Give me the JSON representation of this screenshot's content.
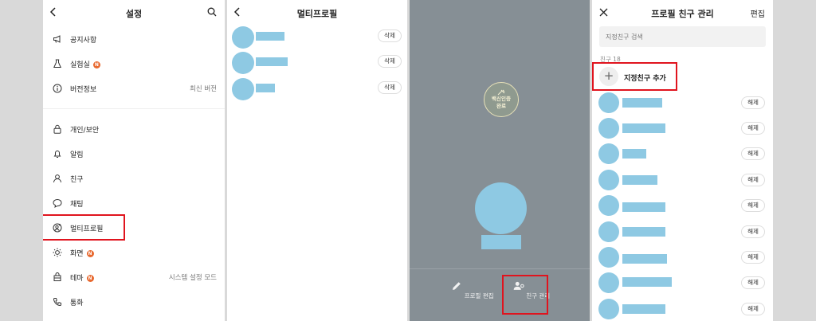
{
  "settings": {
    "title": "설정",
    "items": [
      {
        "label": "공지사항",
        "icon": "megaphone-icon",
        "new": false,
        "value": ""
      },
      {
        "label": "실험실",
        "icon": "flask-icon",
        "new": true,
        "value": ""
      },
      {
        "label": "버전정보",
        "icon": "info-icon",
        "new": false,
        "value": "최신 버전"
      },
      {
        "label": "개인/보안",
        "icon": "lock-icon",
        "new": false,
        "value": ""
      },
      {
        "label": "알림",
        "icon": "bell-icon",
        "new": false,
        "value": ""
      },
      {
        "label": "친구",
        "icon": "person-icon",
        "new": false,
        "value": ""
      },
      {
        "label": "채팅",
        "icon": "chat-bubble-icon",
        "new": false,
        "value": ""
      },
      {
        "label": "멀티프로필",
        "icon": "multi-profile-icon",
        "new": false,
        "value": ""
      },
      {
        "label": "화면",
        "icon": "sun-icon",
        "new": true,
        "value": ""
      },
      {
        "label": "테마",
        "icon": "theme-icon",
        "new": true,
        "value": "시스템 설정 모드"
      },
      {
        "label": "통화",
        "icon": "phone-icon",
        "new": false,
        "value": ""
      }
    ],
    "new_badge": "N"
  },
  "multiprofile": {
    "title": "멀티프로필",
    "delete_label": "삭제",
    "rows": 3
  },
  "profile": {
    "badge_line1": "백신인증",
    "badge_line2": "완료",
    "edit_label": "프로필 편집",
    "manage_label": "친구 관리"
  },
  "friends": {
    "title": "프로필 친구 관리",
    "edit_label": "편집",
    "search_placeholder": "지정친구 검색",
    "count_label": "친구 18",
    "add_label": "지정친구 추가",
    "release_label": "해제",
    "rows": 9
  },
  "colors": {
    "highlight": "#e0141e",
    "placeholder_blue": "#8ec9e3",
    "profile_bg": "#868f95",
    "new_badge": "#e8692f"
  }
}
